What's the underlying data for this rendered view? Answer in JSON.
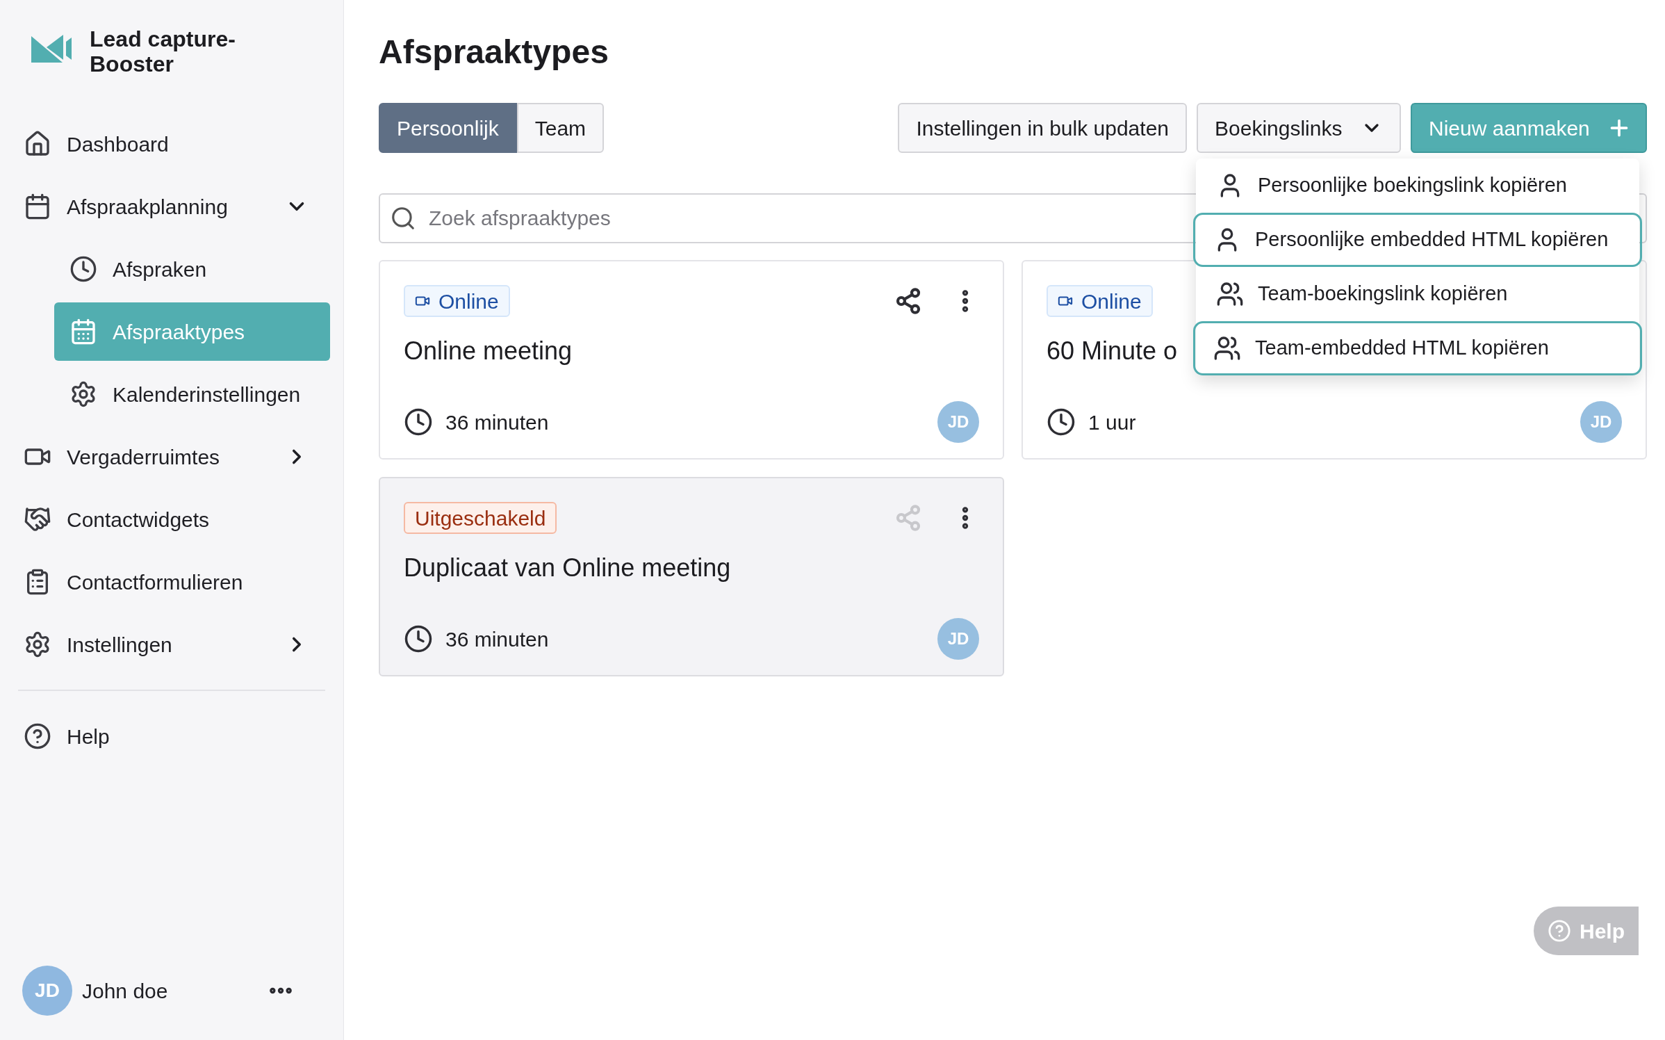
{
  "brand": {
    "name": "Lead capture-Booster"
  },
  "nav": [
    {
      "label": "Dashboard"
    },
    {
      "label": "Afspraakplanning",
      "expanded": true,
      "children": [
        {
          "label": "Afspraken",
          "selected": false
        },
        {
          "label": "Afspraaktypes",
          "selected": true
        },
        {
          "label": "Kalenderinstellingen",
          "selected": false
        }
      ]
    },
    {
      "label": "Vergaderruimtes",
      "expanded": false
    },
    {
      "label": "Contactwidgets"
    },
    {
      "label": "Contactformulieren"
    },
    {
      "label": "Instellingen",
      "expanded": false
    }
  ],
  "help": {
    "label": "Help"
  },
  "user": {
    "initials": "JD",
    "name": "John doe"
  },
  "page": {
    "title": "Afspraaktypes"
  },
  "tabs": [
    {
      "label": "Persoonlijk",
      "selected": true
    },
    {
      "label": "Team",
      "selected": false
    }
  ],
  "actions": {
    "bulk": "Instellingen in bulk updaten",
    "links": "Boekingslinks",
    "create": "Nieuw aanmaken"
  },
  "menu": [
    {
      "label": "Persoonlijke boekingslink kopiëren",
      "kind": "person",
      "highlighted": false
    },
    {
      "label": "Persoonlijke embedded HTML kopiëren",
      "kind": "person",
      "highlighted": true
    },
    {
      "label": "Team-boekingslink kopiëren",
      "kind": "team",
      "highlighted": false
    },
    {
      "label": "Team-embedded HTML kopiëren",
      "kind": "team",
      "highlighted": true
    }
  ],
  "search": {
    "placeholder": "Zoek afspraaktypes"
  },
  "cards": [
    {
      "badge": {
        "kind": "online",
        "label": "Online"
      },
      "title": "Online meeting",
      "duration": "36 minuten",
      "avatar": "JD",
      "disabled": false
    },
    {
      "badge": {
        "kind": "online",
        "label": "Online"
      },
      "title": "60 Minute o",
      "duration": "1 uur",
      "avatar": "JD",
      "disabled": false
    },
    {
      "badge": {
        "kind": "disabled",
        "label": "Uitgeschakeld"
      },
      "title": "Duplicaat van Online meeting",
      "duration": "36 minuten",
      "avatar": "JD",
      "disabled": true
    }
  ],
  "floating_help": {
    "label": "Help"
  }
}
